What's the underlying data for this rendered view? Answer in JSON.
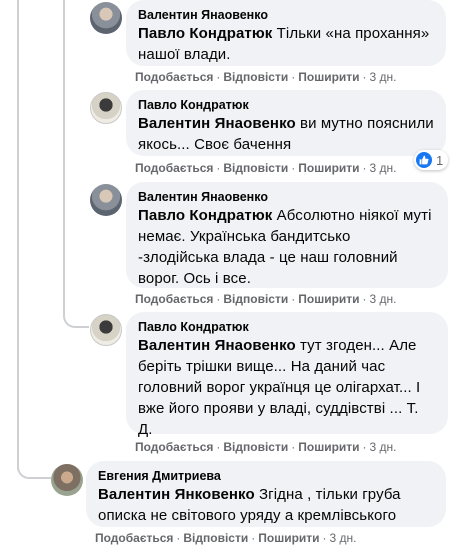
{
  "colors": {
    "bubble": "#f0f2f5",
    "meta_text": "#65676b",
    "like_blue": "#1877f2",
    "thread_line": "#ced0d4"
  },
  "actions": {
    "like": "Подобається",
    "reply": "Відповісти",
    "share": "Поширити",
    "separator": "·"
  },
  "comments": [
    {
      "author": "Валентин Янаовенко",
      "avatar_icon": "user-avatar-photo",
      "mention": "Павло Кондратюк",
      "text_lines": [
        "Тільки «на прохання»",
        "нашої влади."
      ],
      "time": "3 дн."
    },
    {
      "author": "Павло Кондратюк",
      "avatar_icon": "user-avatar-photo",
      "mention": "Валентин Янаовенко",
      "text_lines": [
        "ви мутно пояснили",
        "якось... Своє бачення"
      ],
      "time": "3 дн.",
      "reaction": {
        "icon": "thumbs-up-icon",
        "count": "1"
      }
    },
    {
      "author": "Валентин Янаовенко",
      "avatar_icon": "user-avatar-photo",
      "mention": "Павло Кондратюк",
      "text_lines": [
        "Абсолютно ніякої муті",
        "немає. Українська бандитсько",
        "-злодійська влада - це наш головний",
        "ворог. Ось і все."
      ],
      "time": "3 дн."
    },
    {
      "author": "Павло Кондратюк",
      "avatar_icon": "user-avatar-photo",
      "mention": "Валентин Янаовенко",
      "text_lines": [
        "тут згоден... Але",
        "беріть трішки вище... На даний час",
        "головний ворог українця це олігархат... І",
        "вже його прояви у владі, суддівстві ... Т.",
        "Д."
      ],
      "time": "3 дн."
    },
    {
      "author": "Евгения Дмитриева",
      "avatar_icon": "user-avatar-photo",
      "mention": "Валентин Янковенко",
      "text_lines": [
        "Згідна , тільки груба",
        "описка не світового уряду а кремлівського"
      ],
      "time": "3 дн."
    }
  ]
}
